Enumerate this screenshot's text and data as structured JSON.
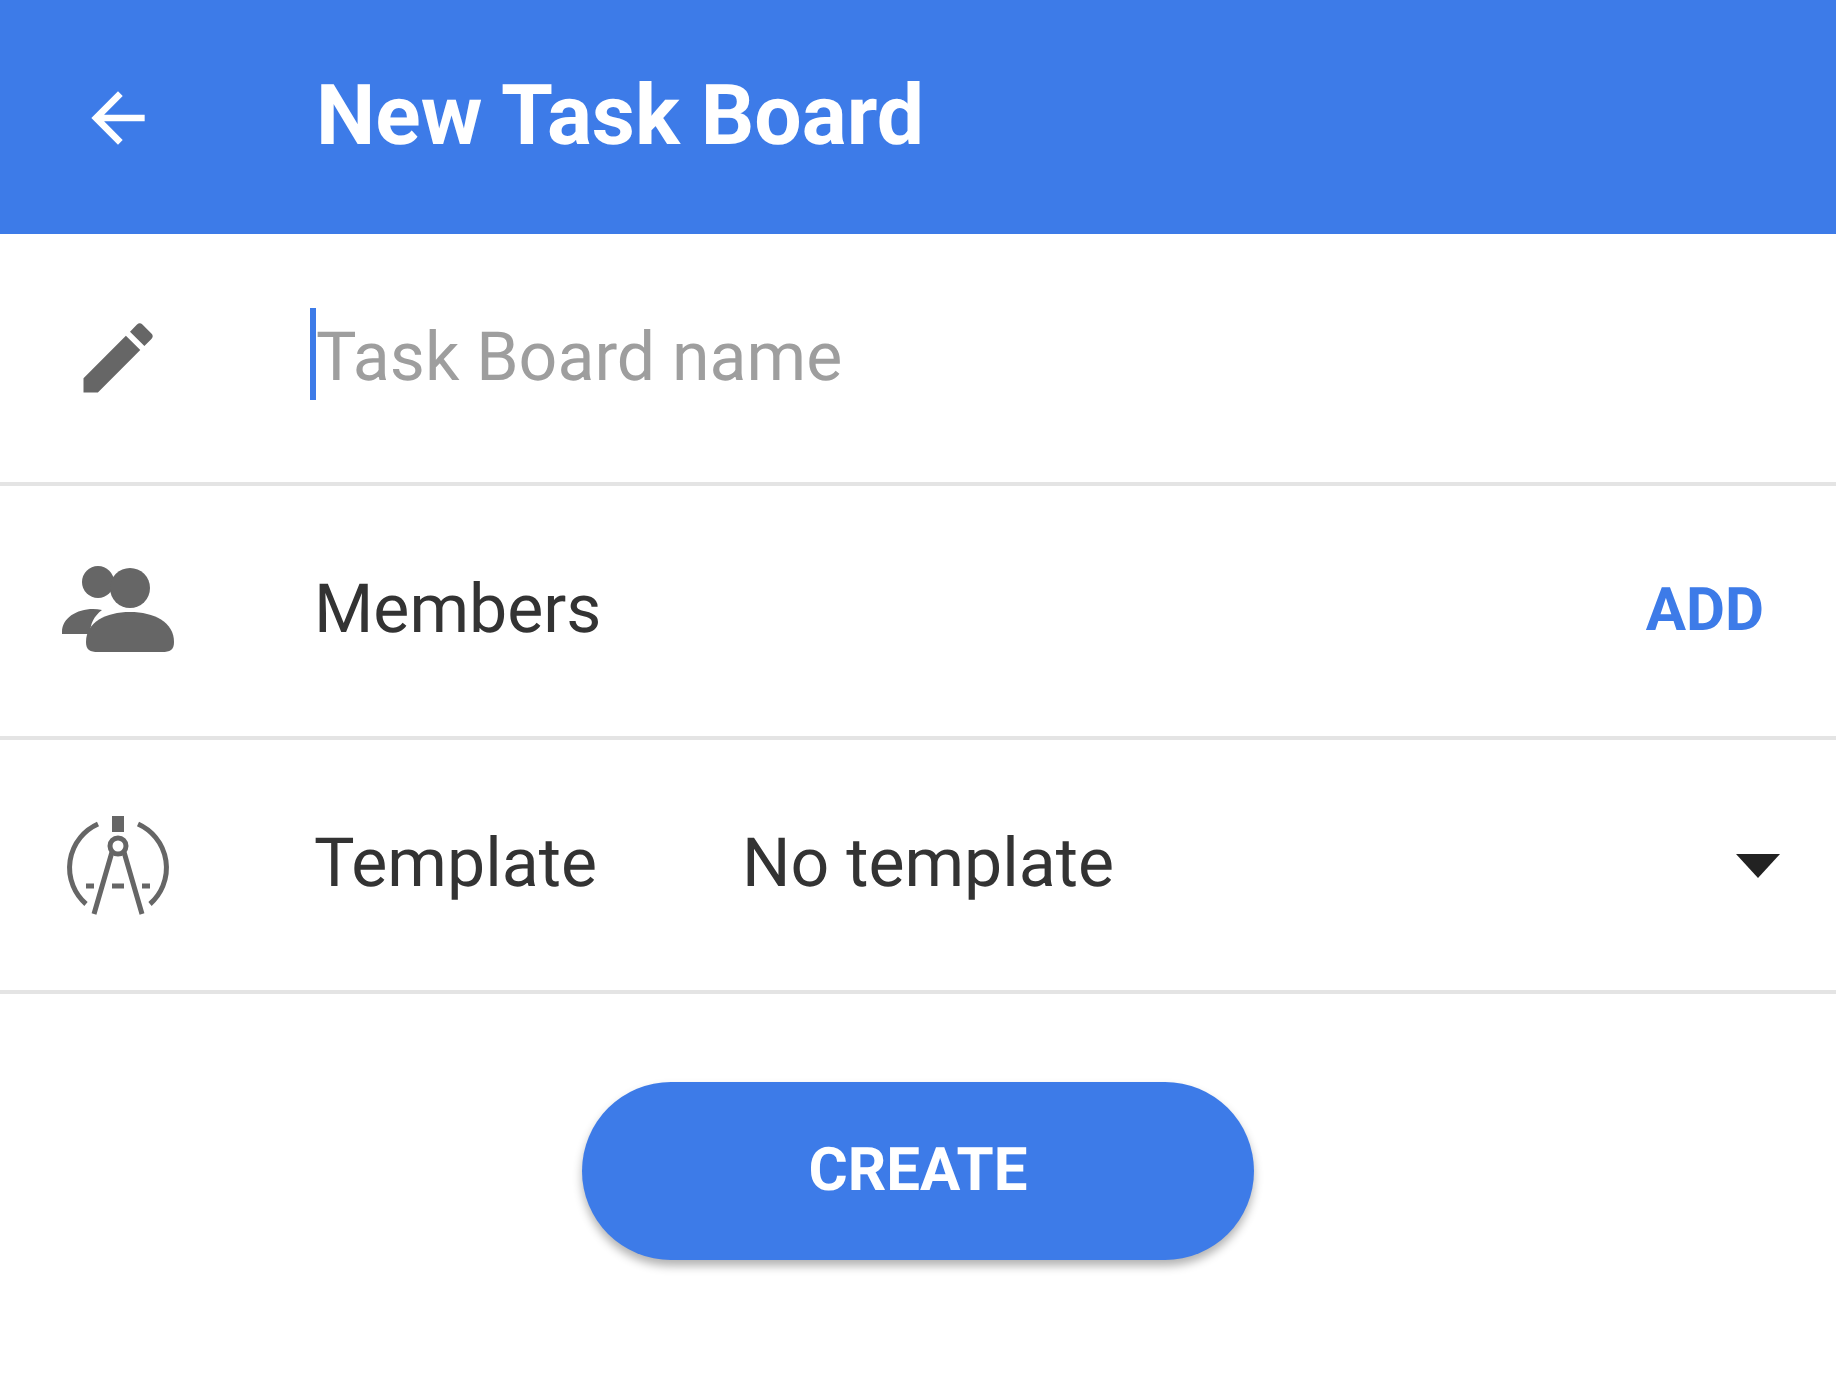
{
  "app_bar": {
    "title": "New Task Board"
  },
  "name_field": {
    "placeholder": "Task Board name",
    "focused": true
  },
  "members": {
    "label": "Members",
    "action": "ADD"
  },
  "template": {
    "label": "Template",
    "value": "No template"
  },
  "create_button": {
    "label": "CREATE"
  }
}
